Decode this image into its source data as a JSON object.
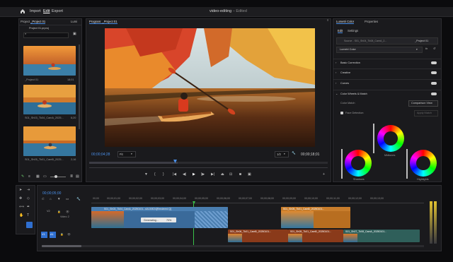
{
  "menu": {
    "home_icon": "home-icon",
    "import": "Import",
    "edit": "Edit",
    "export": "Export"
  },
  "window": {
    "title": "video-editing",
    "status": "Edited"
  },
  "project_panel": {
    "tabs": [
      "Project",
      "_Project 01",
      "Lumi"
    ],
    "path": "Project 01.prproj",
    "items": [
      {
        "name": "",
        "duration": ""
      },
      {
        "name": "_Project 01",
        "duration": "18;01"
      },
      {
        "name": "S01_Sh03_Tk04_CamA_2025...",
        "duration": "6;20"
      },
      {
        "name": "S01_Sh05_Tk01_CamB_2025...",
        "duration": "2;16"
      }
    ]
  },
  "program_monitor": {
    "tab": "Program: _Project 01",
    "timecode": "00;00;04;28",
    "fit": "Fit",
    "resolution": "1/2",
    "duration": "00;00;18;01"
  },
  "lumetri": {
    "tabs": [
      "Lumetri Color",
      "Properties"
    ],
    "subtabs": [
      "Edit",
      "Settings"
    ],
    "source": "Source - S01_Sh04_Tk08_CamA_2...",
    "target": "_Project 01",
    "effect": "Lumetri Color",
    "sections": [
      "Basic Correction",
      "Creative",
      "Curves",
      "Color Wheels & Match"
    ],
    "color_match": "Color Match",
    "comparison_view": "Comparison View",
    "face_detection": "Face Detection",
    "apply_match": "Apply Match",
    "wheels": [
      "Midtones",
      "Shadows",
      "Highlights"
    ]
  },
  "timeline": {
    "timecode": "00;00;05;00",
    "ruler": [
      "00;00",
      "00;00;01;00",
      "00;00;02;00",
      "00;00;03;00",
      "00;00;04;00",
      "00;00;05;00",
      "00;00;06;00",
      "00;00;07;00",
      "00;00;08;00",
      "00;00;09;00",
      "00;00;10;00",
      "00;00;11;00",
      "00;00;12;00",
      "00;00;13;00"
    ],
    "tracks": {
      "v2": "V2",
      "video2": "Video 2",
      "v1": "V1",
      "a1": "A1"
    },
    "clips": [
      "S01_Sh03_Tk04_CamA_20250101...s0L00E24[Rendered Q]",
      "S01_Sh05_Tk01_CamB_20250101...",
      "S01_Sh06_Tk01_CamB_20250101...",
      "S01_Sh05_Tk01_CamB_20250101...",
      "S01_Sh07_Tk08_CamA_20250101..."
    ],
    "generating": "Generating...",
    "progress": "70%",
    "progress_fraction": 0.7
  },
  "colors": {
    "accent": "#4a8fe8",
    "playhead": "#3ac24a",
    "clip_blue": "#3a6a9a",
    "clip_orange": "#b86e20",
    "clip_teal": "#2f5f5a",
    "audio_blue": "#2b5ea6"
  }
}
